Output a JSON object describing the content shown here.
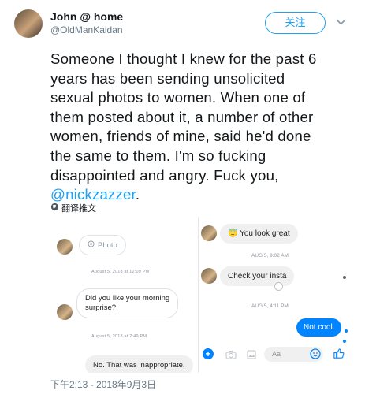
{
  "user": {
    "name": "John @ home",
    "handle": "@OldManKaidan"
  },
  "follow_label": "关注",
  "chevron_icon": "chevron-down-icon",
  "tweet": {
    "lines": [
      "Someone I thought I knew for the past 6",
      "years has been sending unsolicited",
      "sexual photos to women. When one of",
      "them posted about it, a number of other",
      "women, friends of mine, said he'd done",
      "the same to them. I'm so fucking",
      "disappointed and angry. Fuck you,"
    ],
    "mention": "@nickzazzer",
    "mention_suffix": "."
  },
  "translate_label": "翻译推文",
  "timestamp": "下午2:13 - 2018年9月3日",
  "left_chat": {
    "photo_label": "Photo",
    "ts1": "August 5, 2018 at 12:09 PM",
    "bubble1_line1": "Did you like your morning",
    "bubble1_line2": "surprise?",
    "ts2": "August 5, 2018 at 2:49 PM",
    "bubble2": "No. That was inappropriate."
  },
  "right_chat": {
    "msg1_emoji": "😇",
    "msg1": "You look great",
    "ts1": "AUG 5, 9:02 AM",
    "msg2": "Check your insta",
    "ts2": "AUG 5, 4:11 PM",
    "msg3": "Not cool.",
    "input_placeholder": "Aa"
  },
  "colors": {
    "accent": "#1da1f2",
    "messenger_blue": "#0084ff"
  }
}
